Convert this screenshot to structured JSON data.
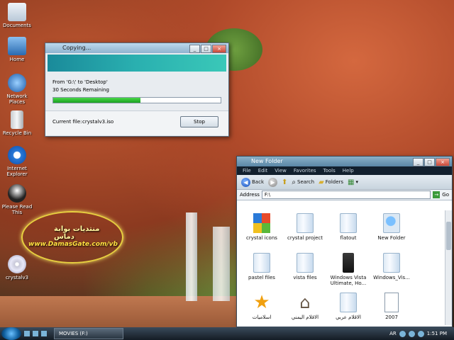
{
  "desktop": {
    "icons": [
      {
        "label": "Documents"
      },
      {
        "label": "Home"
      },
      {
        "label": "Network Places"
      },
      {
        "label": "Recycle Bin"
      },
      {
        "label": "Internet Explorer"
      },
      {
        "label": "Please Read This"
      },
      {
        "label": "crystalv3"
      }
    ],
    "logo_line1": "منتديات بوابة دماس",
    "logo_line2": "www.DamasGate.com/vb"
  },
  "copy_dialog": {
    "title": "Copying...",
    "from_to": "From 'G:\\' to 'Desktop'",
    "remaining": "30 Seconds Remaining",
    "progress": 0.52,
    "current_file_label": "Current file:",
    "current_file": "crystalv3.iso",
    "stop_label": "Stop"
  },
  "explorer": {
    "title": "New Folder",
    "menu": [
      "File",
      "Edit",
      "View",
      "Favorites",
      "Tools",
      "Help"
    ],
    "toolbar": {
      "back": "Back",
      "search": "Search",
      "folders": "Folders"
    },
    "address_label": "Address",
    "address_value": "F:\\",
    "go_label": "Go",
    "items": [
      {
        "label": "crystal icons",
        "icon": "windows-logo-icon"
      },
      {
        "label": "crystal project",
        "icon": "folder-icon"
      },
      {
        "label": "flatout",
        "icon": "folder-icon"
      },
      {
        "label": "New Folder",
        "icon": "globe-folder-icon"
      },
      {
        "label": "pastel files",
        "icon": "folder-icon"
      },
      {
        "label": "vista files",
        "icon": "folder-icon"
      },
      {
        "label": "Windows Vista Ultimate, Ho...",
        "icon": "computer-icon"
      },
      {
        "label": "Windows_Vis...",
        "icon": "folder-icon"
      },
      {
        "label": "اسلاميات",
        "icon": "star-icon"
      },
      {
        "label": "الاقلام اليمني",
        "icon": "house-icon"
      },
      {
        "label": "الاقلام عربي",
        "icon": "folder-icon"
      },
      {
        "label": "2007",
        "icon": "document-icon"
      }
    ]
  },
  "taskbar": {
    "task_label": "MOVIES (F:)",
    "tray_lang": "AR",
    "clock": "1:51 PM"
  }
}
